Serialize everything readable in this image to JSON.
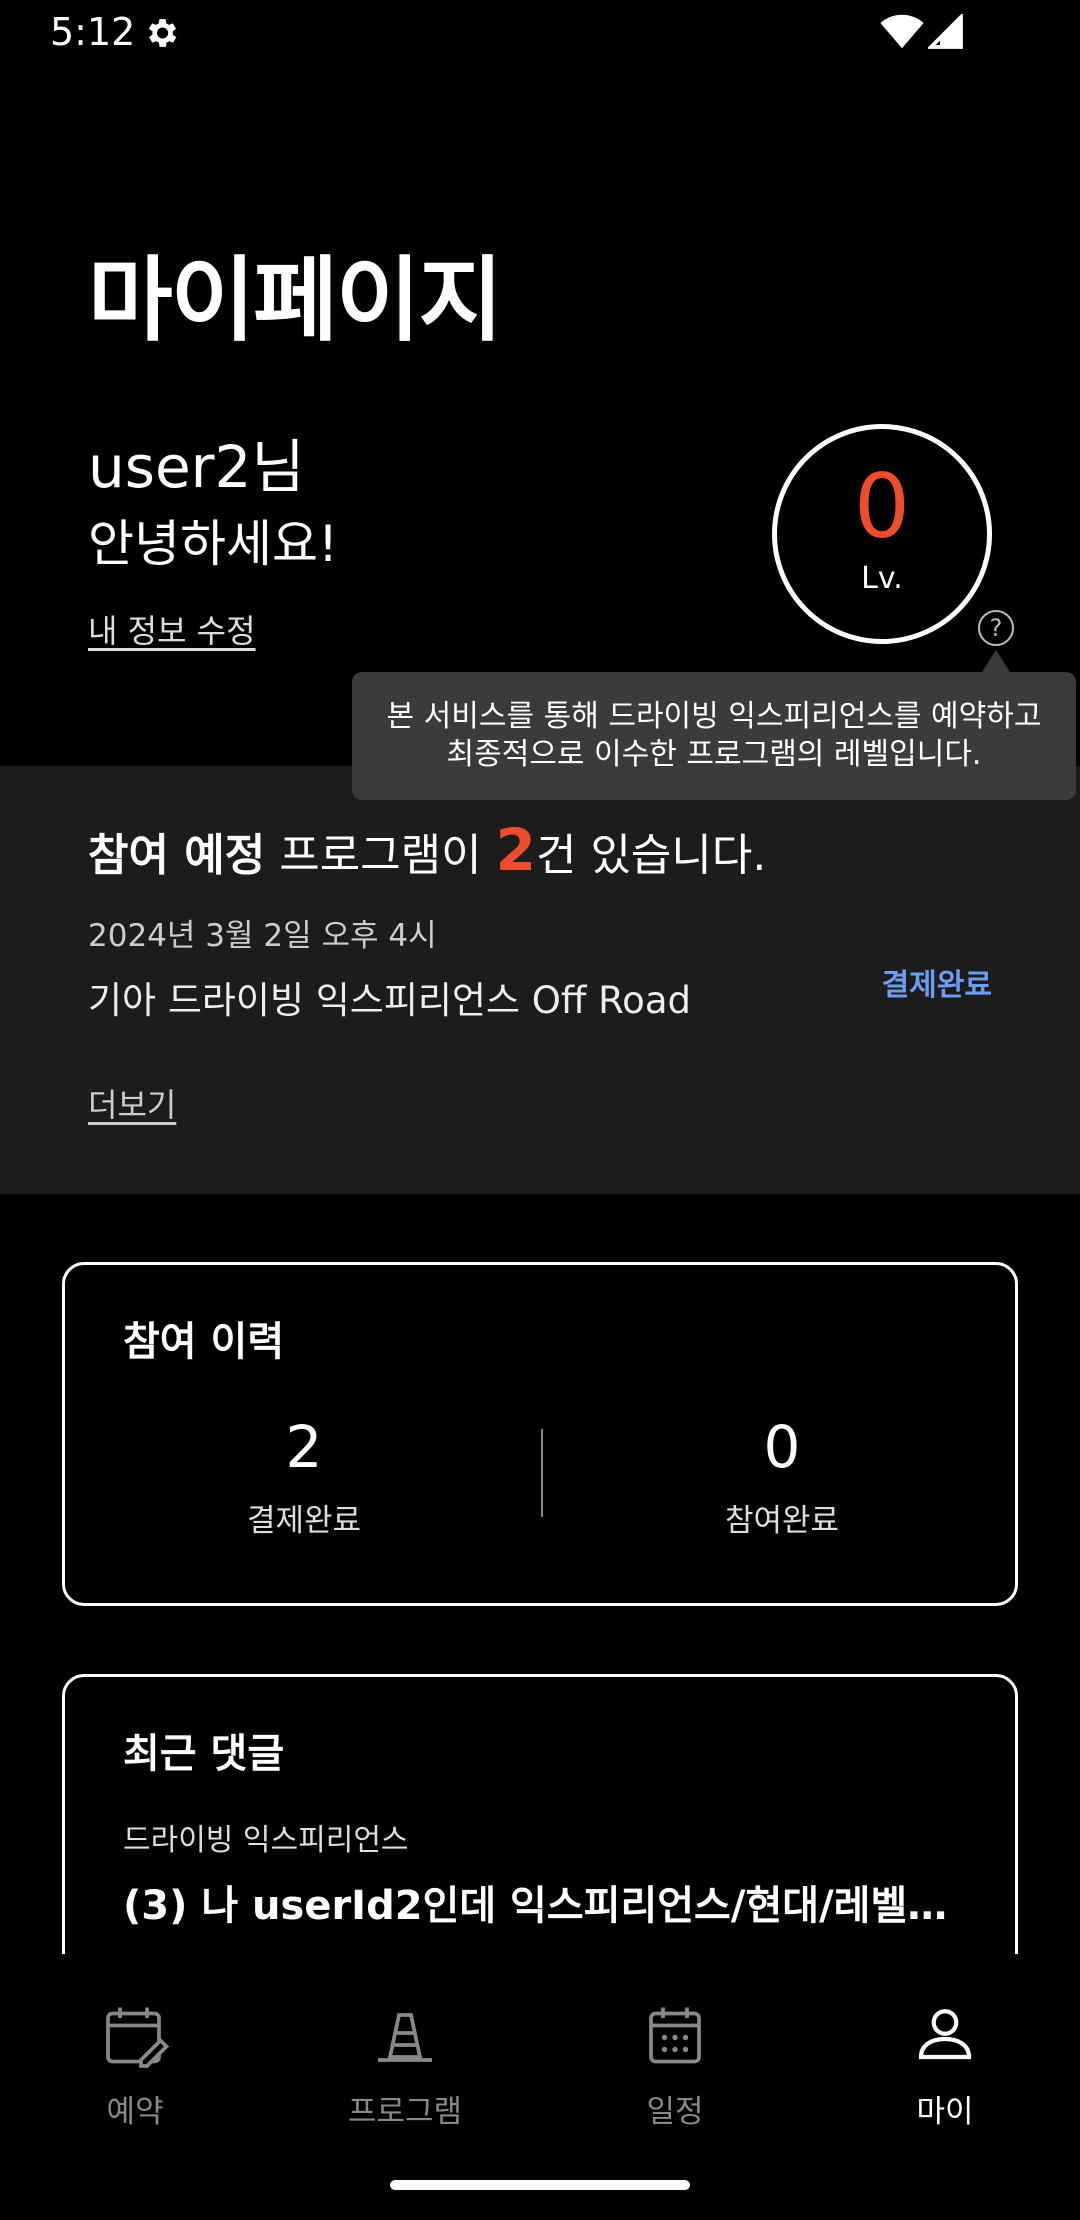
{
  "status_bar": {
    "time": "5:12"
  },
  "header": {
    "title": "마이페이지",
    "username": "user2님",
    "greeting": "안녕하세요!",
    "edit_profile": "내 정보 수정"
  },
  "level": {
    "value": "0",
    "label": "Lv.",
    "help_symbol": "?",
    "tooltip_line1": "본 서비스를 통해 드라이빙 익스피리언스를 예약하고",
    "tooltip_line2": "최종적으로 이수한 프로그램의 레벨입니다."
  },
  "upcoming": {
    "title_bold": "참여 예정",
    "title_mid": " 프로그램이 ",
    "count": "2",
    "title_end": "건 있습니다.",
    "event_date": "2024년 3월 2일 오후 4시",
    "event_name": "기아 드라이빙 익스피리언스 Off Road",
    "event_status": "결제완료",
    "more": "더보기"
  },
  "history": {
    "title": "참여 이력",
    "paid_count": "2",
    "paid_label": "결제완료",
    "done_count": "0",
    "done_label": "참여완료"
  },
  "comments": {
    "title": "최근 댓글",
    "category": "드라이빙 익스피리언스",
    "text": "(3) 나 userId2인데 익스피리언스/현대/레벨…"
  },
  "nav": {
    "items": [
      {
        "label": "예약",
        "icon": "calendar-edit-icon"
      },
      {
        "label": "프로그램",
        "icon": "traffic-cone-icon"
      },
      {
        "label": "일정",
        "icon": "calendar-icon"
      },
      {
        "label": "마이",
        "icon": "person-icon"
      }
    ],
    "active_index": 3
  },
  "colors": {
    "accent": "#ee4d2d",
    "status_blue": "#6e9cf0",
    "panel": "#1c1c1c",
    "tooltip": "#3b3b3b"
  }
}
